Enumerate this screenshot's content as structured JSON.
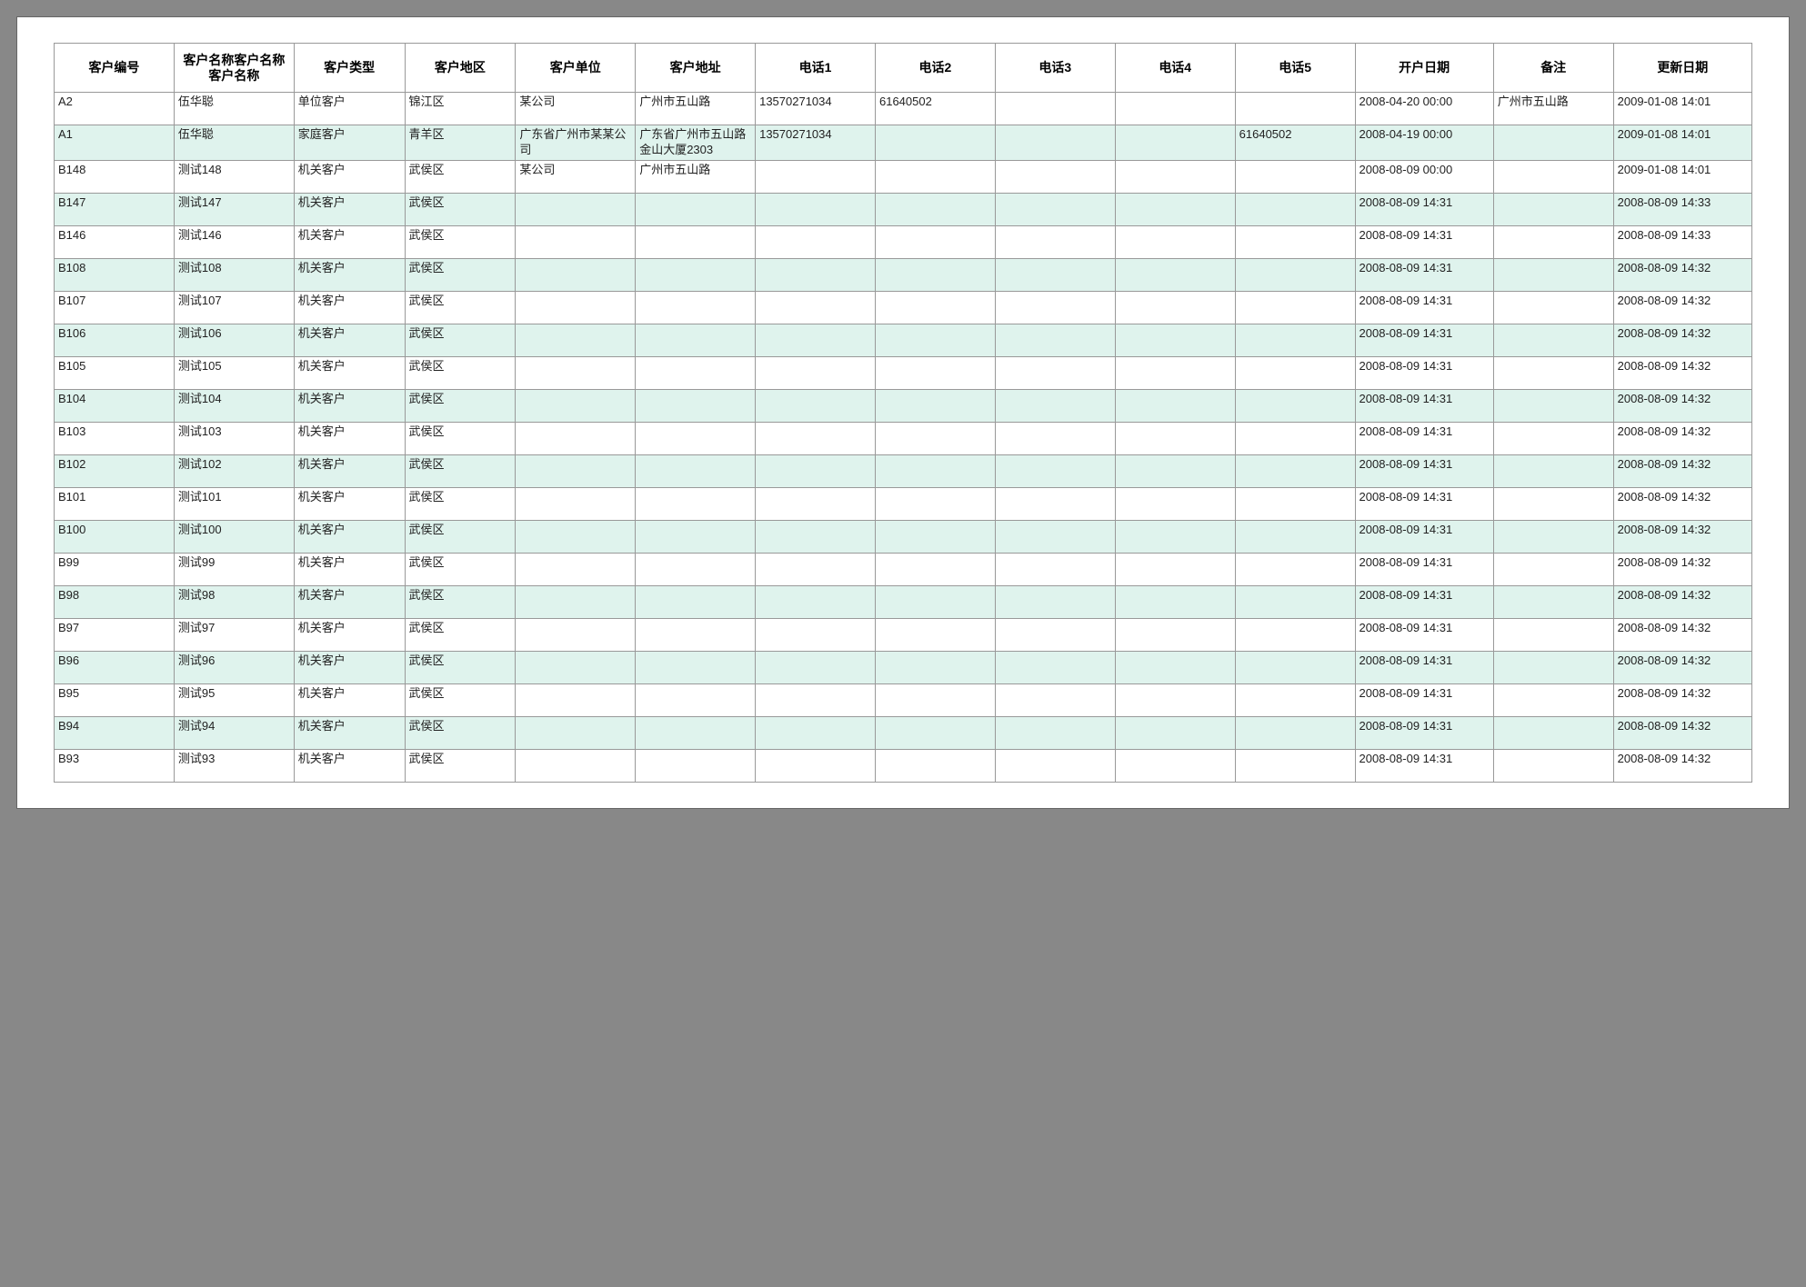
{
  "headers": [
    "客户编号",
    "客户名称客户名称客户名称",
    "客户类型",
    "客户地区",
    "客户单位",
    "客户地址",
    "电话1",
    "电话2",
    "电话3",
    "电话4",
    "电话5",
    "开户日期",
    "备注",
    "更新日期"
  ],
  "rows": [
    {
      "id": "A2",
      "name": "伍华聪",
      "type": "单位客户",
      "area": "锦江区",
      "unit": "某公司",
      "addr": "广州市五山路",
      "tel1": "13570271034",
      "tel2": "61640502",
      "tel3": "",
      "tel4": "",
      "tel5": "",
      "open": "2008-04-20 00:00",
      "remark": "广州市五山路",
      "update": "2009-01-08 14:01"
    },
    {
      "id": "A1",
      "name": "伍华聪",
      "type": "家庭客户",
      "area": "青羊区",
      "unit": "广东省广州市某某公司",
      "addr": "广东省广州市五山路金山大厦2303",
      "tel1": "13570271034",
      "tel2": "",
      "tel3": "",
      "tel4": "",
      "tel5": "61640502",
      "open": "2008-04-19 00:00",
      "remark": "",
      "update": "2009-01-08 14:01"
    },
    {
      "id": "B148",
      "name": "测试148",
      "type": "机关客户",
      "area": "武侯区",
      "unit": "某公司",
      "addr": "广州市五山路",
      "tel1": "",
      "tel2": "",
      "tel3": "",
      "tel4": "",
      "tel5": "",
      "open": "2008-08-09 00:00",
      "remark": "",
      "update": "2009-01-08 14:01"
    },
    {
      "id": "B147",
      "name": "测试147",
      "type": "机关客户",
      "area": "武侯区",
      "unit": "",
      "addr": "",
      "tel1": "",
      "tel2": "",
      "tel3": "",
      "tel4": "",
      "tel5": "",
      "open": "2008-08-09 14:31",
      "remark": "",
      "update": "2008-08-09 14:33"
    },
    {
      "id": "B146",
      "name": "测试146",
      "type": "机关客户",
      "area": "武侯区",
      "unit": "",
      "addr": "",
      "tel1": "",
      "tel2": "",
      "tel3": "",
      "tel4": "",
      "tel5": "",
      "open": "2008-08-09 14:31",
      "remark": "",
      "update": "2008-08-09 14:33"
    },
    {
      "id": "B108",
      "name": "测试108",
      "type": "机关客户",
      "area": "武侯区",
      "unit": "",
      "addr": "",
      "tel1": "",
      "tel2": "",
      "tel3": "",
      "tel4": "",
      "tel5": "",
      "open": "2008-08-09 14:31",
      "remark": "",
      "update": "2008-08-09 14:32"
    },
    {
      "id": "B107",
      "name": "测试107",
      "type": "机关客户",
      "area": "武侯区",
      "unit": "",
      "addr": "",
      "tel1": "",
      "tel2": "",
      "tel3": "",
      "tel4": "",
      "tel5": "",
      "open": "2008-08-09 14:31",
      "remark": "",
      "update": "2008-08-09 14:32"
    },
    {
      "id": "B106",
      "name": "测试106",
      "type": "机关客户",
      "area": "武侯区",
      "unit": "",
      "addr": "",
      "tel1": "",
      "tel2": "",
      "tel3": "",
      "tel4": "",
      "tel5": "",
      "open": "2008-08-09 14:31",
      "remark": "",
      "update": "2008-08-09 14:32"
    },
    {
      "id": "B105",
      "name": "测试105",
      "type": "机关客户",
      "area": "武侯区",
      "unit": "",
      "addr": "",
      "tel1": "",
      "tel2": "",
      "tel3": "",
      "tel4": "",
      "tel5": "",
      "open": "2008-08-09 14:31",
      "remark": "",
      "update": "2008-08-09 14:32"
    },
    {
      "id": "B104",
      "name": "测试104",
      "type": "机关客户",
      "area": "武侯区",
      "unit": "",
      "addr": "",
      "tel1": "",
      "tel2": "",
      "tel3": "",
      "tel4": "",
      "tel5": "",
      "open": "2008-08-09 14:31",
      "remark": "",
      "update": "2008-08-09 14:32"
    },
    {
      "id": "B103",
      "name": "测试103",
      "type": "机关客户",
      "area": "武侯区",
      "unit": "",
      "addr": "",
      "tel1": "",
      "tel2": "",
      "tel3": "",
      "tel4": "",
      "tel5": "",
      "open": "2008-08-09 14:31",
      "remark": "",
      "update": "2008-08-09 14:32"
    },
    {
      "id": "B102",
      "name": "测试102",
      "type": "机关客户",
      "area": "武侯区",
      "unit": "",
      "addr": "",
      "tel1": "",
      "tel2": "",
      "tel3": "",
      "tel4": "",
      "tel5": "",
      "open": "2008-08-09 14:31",
      "remark": "",
      "update": "2008-08-09 14:32"
    },
    {
      "id": "B101",
      "name": "测试101",
      "type": "机关客户",
      "area": "武侯区",
      "unit": "",
      "addr": "",
      "tel1": "",
      "tel2": "",
      "tel3": "",
      "tel4": "",
      "tel5": "",
      "open": "2008-08-09 14:31",
      "remark": "",
      "update": "2008-08-09 14:32"
    },
    {
      "id": "B100",
      "name": "测试100",
      "type": "机关客户",
      "area": "武侯区",
      "unit": "",
      "addr": "",
      "tel1": "",
      "tel2": "",
      "tel3": "",
      "tel4": "",
      "tel5": "",
      "open": "2008-08-09 14:31",
      "remark": "",
      "update": "2008-08-09 14:32"
    },
    {
      "id": "B99",
      "name": "测试99",
      "type": "机关客户",
      "area": "武侯区",
      "unit": "",
      "addr": "",
      "tel1": "",
      "tel2": "",
      "tel3": "",
      "tel4": "",
      "tel5": "",
      "open": "2008-08-09 14:31",
      "remark": "",
      "update": "2008-08-09 14:32"
    },
    {
      "id": "B98",
      "name": "测试98",
      "type": "机关客户",
      "area": "武侯区",
      "unit": "",
      "addr": "",
      "tel1": "",
      "tel2": "",
      "tel3": "",
      "tel4": "",
      "tel5": "",
      "open": "2008-08-09 14:31",
      "remark": "",
      "update": "2008-08-09 14:32"
    },
    {
      "id": "B97",
      "name": "测试97",
      "type": "机关客户",
      "area": "武侯区",
      "unit": "",
      "addr": "",
      "tel1": "",
      "tel2": "",
      "tel3": "",
      "tel4": "",
      "tel5": "",
      "open": "2008-08-09 14:31",
      "remark": "",
      "update": "2008-08-09 14:32"
    },
    {
      "id": "B96",
      "name": "测试96",
      "type": "机关客户",
      "area": "武侯区",
      "unit": "",
      "addr": "",
      "tel1": "",
      "tel2": "",
      "tel3": "",
      "tel4": "",
      "tel5": "",
      "open": "2008-08-09 14:31",
      "remark": "",
      "update": "2008-08-09 14:32"
    },
    {
      "id": "B95",
      "name": "测试95",
      "type": "机关客户",
      "area": "武侯区",
      "unit": "",
      "addr": "",
      "tel1": "",
      "tel2": "",
      "tel3": "",
      "tel4": "",
      "tel5": "",
      "open": "2008-08-09 14:31",
      "remark": "",
      "update": "2008-08-09 14:32"
    },
    {
      "id": "B94",
      "name": "测试94",
      "type": "机关客户",
      "area": "武侯区",
      "unit": "",
      "addr": "",
      "tel1": "",
      "tel2": "",
      "tel3": "",
      "tel4": "",
      "tel5": "",
      "open": "2008-08-09 14:31",
      "remark": "",
      "update": "2008-08-09 14:32"
    },
    {
      "id": "B93",
      "name": "测试93",
      "type": "机关客户",
      "area": "武侯区",
      "unit": "",
      "addr": "",
      "tel1": "",
      "tel2": "",
      "tel3": "",
      "tel4": "",
      "tel5": "",
      "open": "2008-08-09 14:31",
      "remark": "",
      "update": "2008-08-09 14:32"
    }
  ]
}
